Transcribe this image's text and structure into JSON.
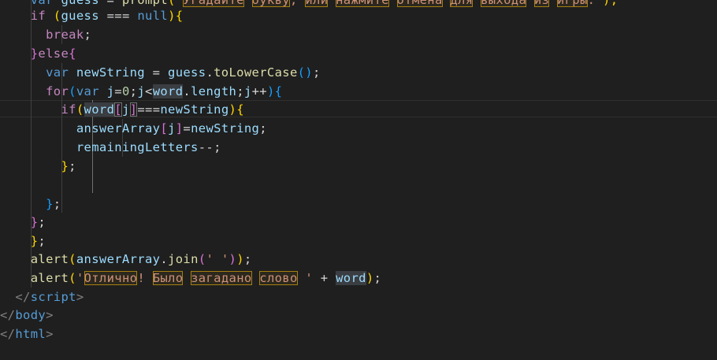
{
  "editor": {
    "line_prompt": {
      "indent": "    ",
      "kw": "var",
      "name": " guess",
      "op": " = ",
      "fn": "prompt",
      "open": "(",
      "q1": "\"",
      "w1": "Угадайте",
      "s1": " ",
      "w2": "букву",
      "s2": ", ",
      "w3": "или",
      "s3": " ",
      "w4": "нажмите",
      "s4": " ",
      "w5": "Отмена",
      "s5": " ",
      "w6": "для",
      "s6": " ",
      "w7": "выхода",
      "s7": " ",
      "w8": "из",
      "s8": " ",
      "w9": "игры",
      "s9": ".\"",
      "close": ");"
    },
    "line_if": {
      "indent": "    ",
      "kw": "if",
      "sp": " ",
      "open": "(",
      "var": "guess",
      "op": " === ",
      "null": "null",
      "close": ")",
      "brace": "{"
    },
    "line_break": {
      "indent": "      ",
      "kw": "break",
      "semi": ";"
    },
    "line_else": {
      "indent": "    ",
      "close": "}",
      "kw": "else",
      "brace": "{"
    },
    "line_newstring": {
      "indent": "      ",
      "kw": "var",
      "sp": " ",
      "var": "newString",
      "op": " = ",
      "obj": "guess",
      "dot": ".",
      "fn": "toLowerCase",
      "parens": "()",
      "semi": ";"
    },
    "line_for": {
      "indent": "      ",
      "kw": "for",
      "open": "(",
      "kw2": "var",
      "sp": " ",
      "v1": "j",
      "eq": "=",
      "n0": "0",
      "s1": ";",
      "v2": "j",
      "lt": "<",
      "word": "word",
      "dot": ".",
      "length": "length",
      "s2": ";",
      "v3": "j",
      "inc": "++",
      "close": ")",
      "brace": "{"
    },
    "line_ifword": {
      "indent": "        ",
      "kw": "if",
      "open": "(",
      "word": "word",
      "lb": "[",
      "j": "j",
      "rb": "]",
      "op": "===",
      "var": "newString",
      "close": ")",
      "brace": "{"
    },
    "line_assign": {
      "indent": "          ",
      "arr": "answerArray",
      "lb": "[",
      "j": "j",
      "rb": "]",
      "eq": "=",
      "var": "newString",
      "semi": ";"
    },
    "line_remaining": {
      "indent": "          ",
      "var": "remainingLetters",
      "dec": "--",
      "semi": ";"
    },
    "line_close_if": {
      "indent": "        ",
      "brace": "}",
      "semi": ";"
    },
    "line_close_for": {
      "indent": "      ",
      "brace": "}",
      "semi": ";"
    },
    "line_close_else": {
      "indent": "    ",
      "brace": "}",
      "semi": ";"
    },
    "line_close_while": {
      "indent": "    ",
      "brace": "}",
      "semi": ";"
    },
    "line_alert1": {
      "indent": "    ",
      "fn": "alert",
      "open": "(",
      "obj": "answerArray",
      "dot": ".",
      "join": "join",
      "open2": "(",
      "str": "' '",
      "close2": ")",
      "close": ")",
      "semi": ";"
    },
    "line_alert2": {
      "indent": "    ",
      "fn": "alert",
      "open": "(",
      "q1": "'",
      "w1": "Отлично",
      "s1": "! ",
      "w2": "Было",
      "s2": " ",
      "w3": "загадано",
      "s3": " ",
      "w4": "слово",
      "s4": " '",
      "plus": " + ",
      "word": "word",
      "close": ")",
      "semi": ";"
    },
    "line_script": {
      "indent": "  ",
      "lt": "</",
      "tag": "script",
      "gt": ">"
    },
    "line_body": {
      "lt": "</",
      "tag": "body",
      "gt": ">"
    },
    "line_html": {
      "lt": "</",
      "tag": "html",
      "gt": ">"
    }
  },
  "colors": {
    "background": "#1f1f1f",
    "keyword": "#569cd6",
    "control": "#c586c0",
    "variable": "#9cdcfe",
    "function": "#dcdcaa",
    "string": "#ce9178",
    "number": "#b5cea8",
    "bracket_gold": "#ffd700",
    "bracket_orchid": "#da70d6",
    "bracket_blue": "#179fff",
    "spell_outline": "#a57f10"
  }
}
